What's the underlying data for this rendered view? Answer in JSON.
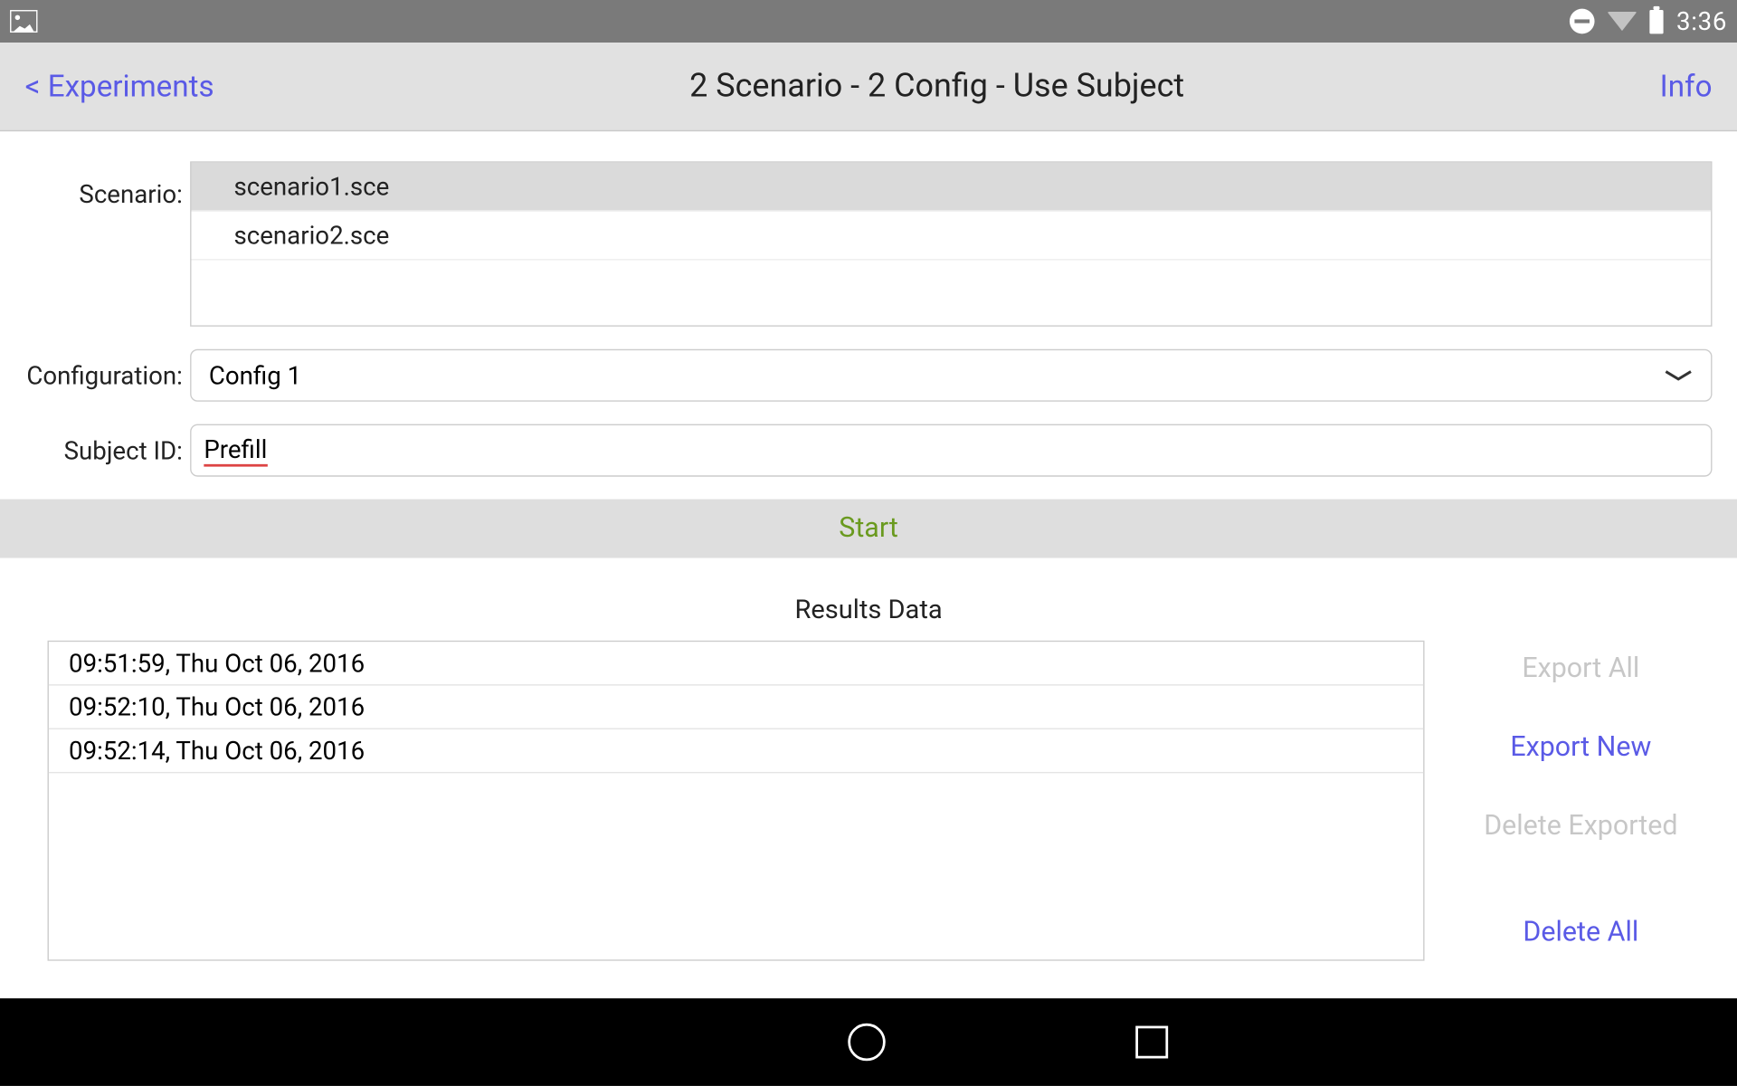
{
  "status": {
    "time": "3:36"
  },
  "appbar": {
    "back": "< Experiments",
    "title": "2 Scenario - 2 Config - Use Subject",
    "info": "Info"
  },
  "form": {
    "scenario_label": "Scenario:",
    "scenarios": [
      "scenario1.sce",
      "scenario2.sce"
    ],
    "selected_scenario_index": 0,
    "config_label": "Configuration:",
    "config_value": "Config 1",
    "subject_label": "Subject ID:",
    "subject_value": "Prefill"
  },
  "start_label": "Start",
  "results": {
    "heading": "Results Data",
    "items": [
      "09:51:59, Thu Oct 06, 2016",
      "09:52:10, Thu Oct 06, 2016",
      "09:52:14, Thu Oct 06, 2016"
    ],
    "actions": {
      "export_all": "Export All",
      "export_new": "Export New",
      "delete_exported": "Delete Exported",
      "delete_all": "Delete All"
    }
  }
}
